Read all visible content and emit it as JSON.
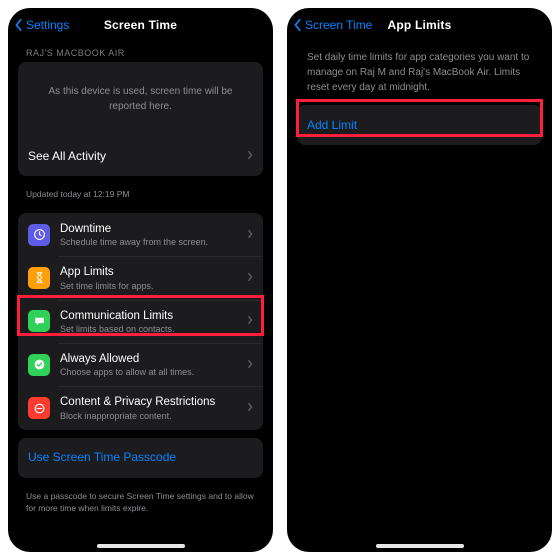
{
  "left": {
    "back": "Settings",
    "title": "Screen Time",
    "device_header": "RAJ'S MACBOOK AIR",
    "usage_placeholder": "As this device is used, screen time will be reported here.",
    "see_all": "See All Activity",
    "updated": "Updated today at 12:19 PM",
    "items": [
      {
        "title": "Downtime",
        "sub": "Schedule time away from the screen."
      },
      {
        "title": "App Limits",
        "sub": "Set time limits for apps."
      },
      {
        "title": "Communication Limits",
        "sub": "Set limits based on contacts."
      },
      {
        "title": "Always Allowed",
        "sub": "Choose apps to allow at all times."
      },
      {
        "title": "Content & Privacy Restrictions",
        "sub": "Block inappropriate content."
      }
    ],
    "passcode": "Use Screen Time Passcode",
    "passcode_help": "Use a passcode to secure Screen Time settings and to allow for more time when limits expire."
  },
  "right": {
    "back": "Screen Time",
    "title": "App Limits",
    "help": "Set daily time limits for app categories you want to manage on Raj M and Raj's MacBook Air. Limits reset every day at midnight.",
    "add": "Add Limit"
  },
  "colors": {
    "downtime": "#5e5ce6",
    "applimits": "#ff9f0a",
    "comm": "#30d158",
    "always": "#30d158",
    "content": "#ff3b30",
    "accent": "#0a84ff"
  }
}
